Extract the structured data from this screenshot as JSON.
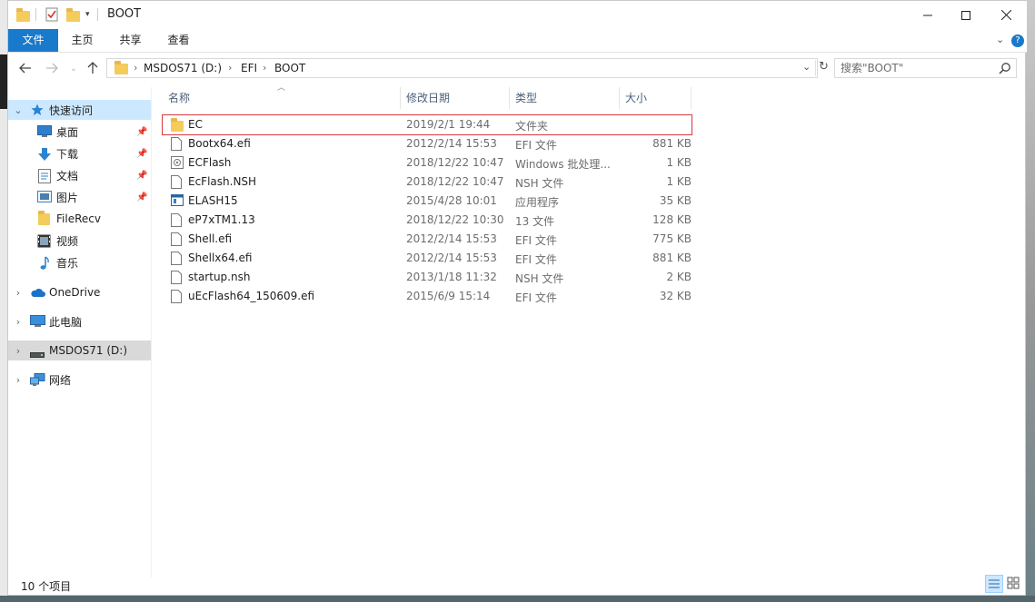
{
  "window": {
    "title": "BOOT",
    "controls": {
      "minimize": "—",
      "maximize": "☐",
      "close": "✕"
    }
  },
  "ribbon": {
    "tabs": [
      {
        "label": "文件",
        "active": true
      },
      {
        "label": "主页"
      },
      {
        "label": "共享"
      },
      {
        "label": "查看"
      }
    ],
    "help": "?"
  },
  "address": {
    "crumbs": [
      "MSDOS71 (D:)",
      "EFI",
      "BOOT"
    ],
    "search_placeholder": "搜索\"BOOT\""
  },
  "nav": {
    "quick_access": "快速访问",
    "pinned": [
      {
        "label": "桌面",
        "icon": "desktop-icon",
        "pinned": true
      },
      {
        "label": "下载",
        "icon": "download-icon",
        "pinned": true
      },
      {
        "label": "文档",
        "icon": "documents-icon",
        "pinned": true
      },
      {
        "label": "图片",
        "icon": "pictures-icon",
        "pinned": true
      },
      {
        "label": "FileRecv",
        "icon": "folder-icon",
        "pinned": false
      },
      {
        "label": "视频",
        "icon": "videos-icon",
        "pinned": false
      },
      {
        "label": "音乐",
        "icon": "music-icon",
        "pinned": false
      }
    ],
    "onedrive": "OneDrive",
    "this_pc": "此电脑",
    "drive": "MSDOS71 (D:)",
    "network": "网络"
  },
  "columns": {
    "name": "名称",
    "date": "修改日期",
    "type": "类型",
    "size": "大小"
  },
  "files": [
    {
      "name": "EC",
      "date": "2019/2/1 19:44",
      "type": "文件夹",
      "size": "",
      "icon": "folder-icon",
      "highlighted": true
    },
    {
      "name": "Bootx64.efi",
      "date": "2012/2/14 15:53",
      "type": "EFI 文件",
      "size": "881 KB",
      "icon": "file-icon"
    },
    {
      "name": "ECFlash",
      "date": "2018/12/22 10:47",
      "type": "Windows 批处理...",
      "size": "1 KB",
      "icon": "batch-file-icon"
    },
    {
      "name": "EcFlash.NSH",
      "date": "2018/12/22 10:47",
      "type": "NSH 文件",
      "size": "1 KB",
      "icon": "file-icon"
    },
    {
      "name": "ELASH15",
      "date": "2015/4/28 10:01",
      "type": "应用程序",
      "size": "35 KB",
      "icon": "application-icon"
    },
    {
      "name": "eP7xTM1.13",
      "date": "2018/12/22 10:30",
      "type": "13 文件",
      "size": "128 KB",
      "icon": "file-icon"
    },
    {
      "name": "Shell.efi",
      "date": "2012/2/14 15:53",
      "type": "EFI 文件",
      "size": "775 KB",
      "icon": "file-icon"
    },
    {
      "name": "Shellx64.efi",
      "date": "2012/2/14 15:53",
      "type": "EFI 文件",
      "size": "881 KB",
      "icon": "file-icon"
    },
    {
      "name": "startup.nsh",
      "date": "2013/1/18 11:32",
      "type": "NSH 文件",
      "size": "2 KB",
      "icon": "file-icon"
    },
    {
      "name": "uEcFlash64_150609.efi",
      "date": "2015/6/9 15:14",
      "type": "EFI 文件",
      "size": "32 KB",
      "icon": "file-icon"
    }
  ],
  "status": {
    "item_count": "10 个项目"
  },
  "colors": {
    "accent": "#1979ca",
    "selection": "#cce8ff",
    "highlight_border": "#d9363e",
    "folder": "#f4cc5b"
  }
}
